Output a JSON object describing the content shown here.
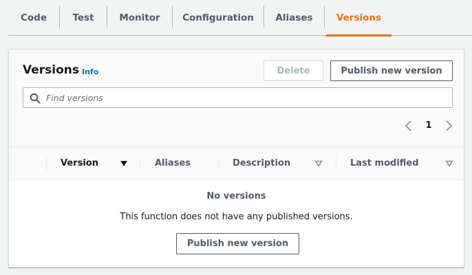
{
  "tabs": [
    {
      "label": "Code"
    },
    {
      "label": "Test"
    },
    {
      "label": "Monitor"
    },
    {
      "label": "Configuration"
    },
    {
      "label": "Aliases"
    },
    {
      "label": "Versions",
      "active": true
    }
  ],
  "panel": {
    "title": "Versions",
    "info_label": "Info",
    "delete_label": "Delete",
    "publish_label": "Publish new version",
    "search": {
      "placeholder": "Find versions",
      "value": ""
    },
    "pagination": {
      "current_page": "1"
    }
  },
  "table": {
    "columns": [
      {
        "label": "Version",
        "sort": "descending"
      },
      {
        "label": "Aliases"
      },
      {
        "label": "Description",
        "sort": "none"
      },
      {
        "label": "Last modified",
        "sort": "none"
      }
    ],
    "rows": []
  },
  "empty_state": {
    "title": "No versions",
    "description": "This function does not have any published versions.",
    "button_label": "Publish new version"
  },
  "colors": {
    "accent": "#ec7211",
    "link": "#0073bb",
    "text": "#16191f",
    "secondary_text": "#545b64",
    "disabled": "#aab7b8"
  },
  "icons": [
    "search-icon",
    "chevron-left-icon",
    "chevron-right-icon",
    "sort-descending-icon",
    "sort-icon"
  ]
}
